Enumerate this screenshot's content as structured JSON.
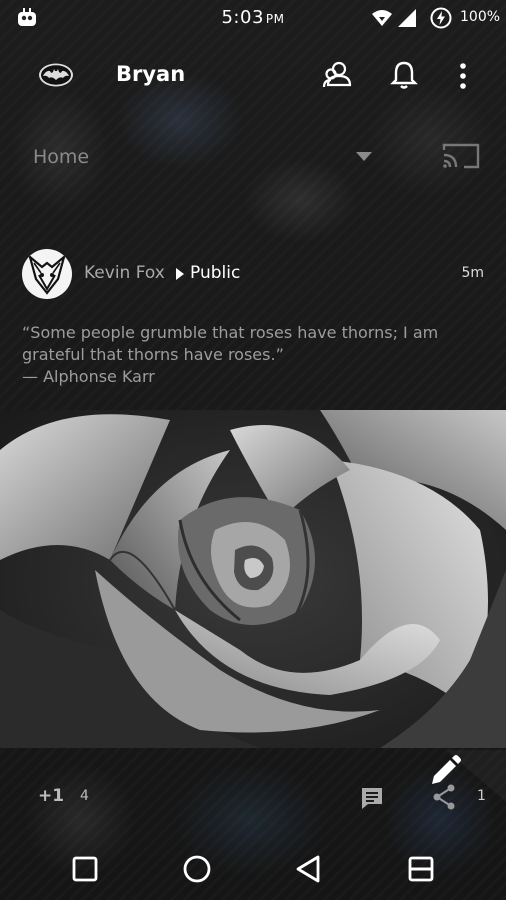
{
  "status_bar": {
    "time": "5:03",
    "ampm": "PM",
    "battery": "100%",
    "icons": [
      "notification-app-icon",
      "wifi-icon",
      "signal-icon",
      "battery-charging-icon"
    ]
  },
  "app_bar": {
    "title": "Bryan",
    "icons": [
      "bat-logo-icon",
      "communities-icon",
      "bell-icon",
      "overflow-menu-icon"
    ]
  },
  "filter": {
    "label": "Home",
    "icons": [
      "dropdown-arrow-icon",
      "cast-icon"
    ]
  },
  "post": {
    "author": "Kevin Fox",
    "visibility": "Public",
    "time": "5m",
    "text_lines": [
      "“Some people grumble that roses have thorns; I am",
      "grateful that thorns have roses.”",
      "— Alphonse Karr"
    ],
    "plus_one_label": "+1",
    "plus_one_count": "4",
    "share_count": "1"
  },
  "colors": {
    "background": "#151515",
    "text_primary": "#ffffff",
    "text_muted": "#9d9d9d"
  },
  "nav_bar": {
    "icons": [
      "recents-icon",
      "home-circle-icon",
      "back-icon",
      "split-screen-icon"
    ]
  }
}
